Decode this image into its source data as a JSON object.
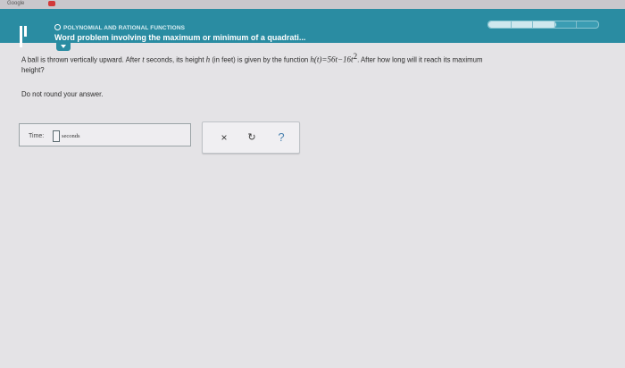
{
  "browser": {
    "tab_label": "Google"
  },
  "header": {
    "topic": "POLYNOMIAL AND RATIONAL FUNCTIONS",
    "title": "Word problem involving the maximum or minimum of a quadrati...",
    "progress_fraction": 0.62,
    "progress_segments": 5
  },
  "question": {
    "text_before": "A ball is thrown vertically upward. After ",
    "var_t": "t",
    "text_mid": " seconds, its height ",
    "var_h": "h",
    "text_mid2": " (in feet) is given by the function ",
    "function_expr": "h(t)=56t−16t",
    "exponent": "2",
    "text_after": ". After how long will it reach its maximum",
    "text_line2": "height?",
    "instruction": "Do not round your answer."
  },
  "answer": {
    "label": "Time:",
    "value": "",
    "unit": "seconds"
  },
  "tools": {
    "clear_glyph": "×",
    "undo_glyph": "↻",
    "help_glyph": "?",
    "clear_icon": "close-icon",
    "undo_icon": "undo-icon",
    "help_icon": "help-icon"
  }
}
